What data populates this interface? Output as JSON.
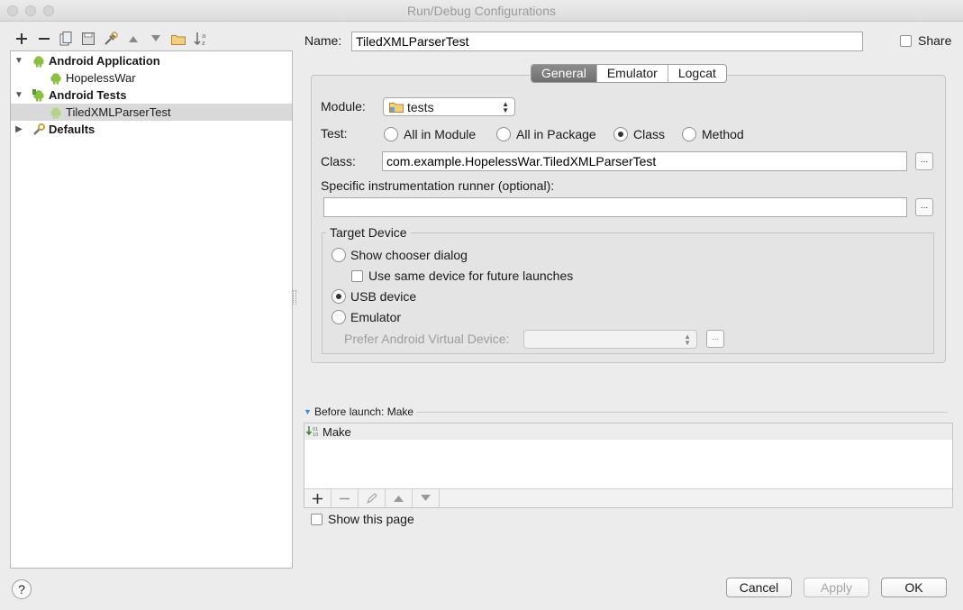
{
  "window": {
    "title": "Run/Debug Configurations"
  },
  "toolbar": {
    "icons": [
      "add-icon",
      "remove-icon",
      "copy-icon",
      "save-icon",
      "edit-defaults-icon",
      "move-up-icon",
      "move-down-icon",
      "folder-icon",
      "sort-icon"
    ]
  },
  "tree": {
    "items": [
      {
        "label": "Android Application",
        "bold": true,
        "expanded": true,
        "level": 0
      },
      {
        "label": "HopelessWar",
        "bold": false,
        "level": 1
      },
      {
        "label": "Android Tests",
        "bold": true,
        "expanded": true,
        "level": 0
      },
      {
        "label": "TiledXMLParserTest",
        "bold": false,
        "level": 1,
        "selected": true
      },
      {
        "label": "Defaults",
        "bold": true,
        "expanded": false,
        "level": 0
      }
    ]
  },
  "name": {
    "label": "Name:",
    "value": "TiledXMLParserTest"
  },
  "share": {
    "label": "Share",
    "checked": false
  },
  "tabs": [
    {
      "label": "General",
      "active": true
    },
    {
      "label": "Emulator",
      "active": false
    },
    {
      "label": "Logcat",
      "active": false
    }
  ],
  "module": {
    "label": "Module:",
    "value": "tests"
  },
  "test": {
    "label": "Test:",
    "options": [
      {
        "label": "All in Module",
        "selected": false
      },
      {
        "label": "All in Package",
        "selected": false
      },
      {
        "label": "Class",
        "selected": true
      },
      {
        "label": "Method",
        "selected": false
      }
    ]
  },
  "class_field": {
    "label": "Class:",
    "value": "com.example.HopelessWar.TiledXMLParserTest",
    "browse": "..."
  },
  "runner": {
    "label": "Specific instrumentation runner (optional):",
    "value": "",
    "browse": "..."
  },
  "target": {
    "title": "Target Device",
    "show_chooser": {
      "label": "Show chooser dialog",
      "selected": false
    },
    "same_device": {
      "label": "Use same device for future launches",
      "checked": false
    },
    "usb": {
      "label": "USB device",
      "selected": true
    },
    "emulator": {
      "label": "Emulator",
      "selected": false
    },
    "prefer_avd": {
      "label": "Prefer Android Virtual Device:",
      "value": "",
      "browse": "..."
    }
  },
  "before_launch": {
    "title": "Before launch: Make",
    "items": [
      "Make"
    ]
  },
  "show_page": {
    "label": "Show this page",
    "checked": false
  },
  "buttons": {
    "help": "?",
    "cancel": "Cancel",
    "apply": "Apply",
    "ok": "OK"
  },
  "colors": {
    "selected_row": "#d9d9d9",
    "active_tab": "#7a7a7a",
    "android_green": "#8bbf3f"
  }
}
